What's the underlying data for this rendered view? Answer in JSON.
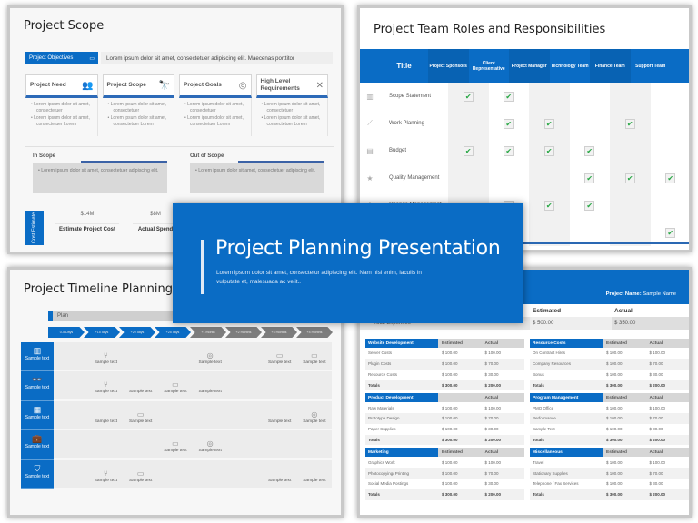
{
  "scope_slide": {
    "title": "Project Scope",
    "objectives_label": "Project Objectives",
    "objectives_icon": "monitor-icon",
    "objectives_text": "Lorem ipsum dolor sit amet, consectetuer adipiscing elit. Maecenas porttitor",
    "cards": [
      {
        "title": "Project Need",
        "icon": "people-icon",
        "glyph": "👥",
        "bullets": [
          "Lorem ipsum dolor sit amet, consectetuer",
          "Lorem ipsum dolor sit amet, consectetuer Lorem"
        ]
      },
      {
        "title": "Project Scope",
        "icon": "telescope-icon",
        "glyph": "🔭",
        "bullets": [
          "Lorem ipsum dolor sit amet, consectetuer",
          "Lorem ipsum dolor sit amet, consectetuer Lorem"
        ]
      },
      {
        "title": "Project Goals",
        "icon": "target-icon",
        "glyph": "◎",
        "bullets": [
          "Lorem ipsum dolor sit amet, consectetuer",
          "Lorem ipsum dolor sit amet, consectetuer Lorem"
        ]
      },
      {
        "title": "High Level Requirements",
        "icon": "tools-icon",
        "glyph": "✕",
        "bullets": [
          "Lorem ipsum dolor sit amet, consectetuer",
          "Lorem ipsum dolor sit amet, consectetuer Lorem"
        ]
      }
    ],
    "in_scope": {
      "label": "In Scope",
      "text": "Lorem ipsum dolor sit amet, consectetuer adipiscing elit."
    },
    "out_scope": {
      "label": "Out of Scope",
      "text": "Lorem ipsum dolor sit amet, consectetuer adipiscing elit."
    },
    "cost_tab": "Cost Estimate",
    "costs": [
      {
        "value": "$14M",
        "label": "Estimate Project Cost"
      },
      {
        "value": "$8M",
        "label": "Actual Spend"
      }
    ]
  },
  "roles_slide": {
    "title": "Project Team Roles and Responsibilities",
    "header_title": "Title",
    "columns": [
      "Project Sponsors",
      "Client Representative",
      "Project Manager",
      "Technology Team",
      "Finance Team",
      "Support Team"
    ],
    "check_glyph": "✔",
    "rows": [
      {
        "name": "Scope Statement",
        "icon": "bar-chart-icon",
        "glyph": "▥",
        "checks": [
          true,
          true,
          false,
          false,
          false,
          false
        ]
      },
      {
        "name": "Work Planning",
        "icon": "line-chart-icon",
        "glyph": "⟋",
        "checks": [
          false,
          true,
          true,
          false,
          true,
          false
        ]
      },
      {
        "name": "Budget",
        "icon": "money-icon",
        "glyph": "▤",
        "checks": [
          true,
          true,
          true,
          true,
          false,
          false
        ]
      },
      {
        "name": "Quality Management",
        "icon": "star-icon",
        "glyph": "★",
        "checks": [
          false,
          false,
          false,
          true,
          true,
          true
        ]
      },
      {
        "name": "Change Management",
        "icon": "team-icon",
        "glyph": "♟",
        "checks": [
          false,
          true,
          true,
          true,
          false,
          false
        ]
      },
      {
        "name": "",
        "icon": "",
        "glyph": "",
        "checks": [
          false,
          false,
          false,
          false,
          false,
          true
        ]
      }
    ]
  },
  "hero": {
    "title": "Project Planning Presentation",
    "subtitle": "Lorem ipsum dolor sit amet, consectetur adipiscing elit. Nam nisl enim, iaculis in vulputate et, malesuada ac velit.."
  },
  "timeline_slide": {
    "title": "Project Timeline Planning",
    "plan_label": "Plan",
    "milestones": [
      {
        "label": "0-5 Days",
        "state": "blue"
      },
      {
        "label": "+15 days",
        "state": "blue"
      },
      {
        "label": "+20 days",
        "state": "blue"
      },
      {
        "label": "+25 days",
        "state": "blue"
      },
      {
        "label": "+1 month",
        "state": "gray"
      },
      {
        "label": "+2 months",
        "state": "gray"
      },
      {
        "label": "+3 months",
        "state": "gray"
      },
      {
        "label": "+4 months",
        "state": "gray"
      }
    ],
    "side_items": [
      {
        "label": "Sample text",
        "icon": "bar-chart-icon",
        "glyph": "▥"
      },
      {
        "label": "Sample text",
        "icon": "binoculars-icon",
        "glyph": "👓"
      },
      {
        "label": "Sample text",
        "icon": "chart-icon",
        "glyph": "▦"
      },
      {
        "label": "Sample text",
        "icon": "briefcase-icon",
        "glyph": "💼"
      },
      {
        "label": "Sample text",
        "icon": "shield-icon",
        "glyph": "⛉"
      }
    ],
    "rows": [
      [
        null,
        {
          "icon": "workflow-icon",
          "glyph": "⑂",
          "label": "Sample text"
        },
        null,
        null,
        {
          "icon": "target-icon",
          "glyph": "◎",
          "label": "Sample text"
        },
        null,
        {
          "icon": "laptop-icon",
          "glyph": "▭",
          "label": "Sample text"
        },
        {
          "icon": "laptop-icon",
          "glyph": "▭",
          "label": "Sample text"
        }
      ],
      [
        null,
        {
          "icon": "workflow-icon",
          "glyph": "⑂",
          "label": "Sample text"
        },
        {
          "icon": "",
          "glyph": "",
          "label": "Sample text"
        },
        {
          "icon": "laptop-icon",
          "glyph": "▭",
          "label": "Sample text"
        },
        {
          "icon": "",
          "glyph": "",
          "label": "Sample text"
        },
        null,
        null,
        null
      ],
      [
        null,
        {
          "icon": "",
          "glyph": "",
          "label": "Sample text"
        },
        {
          "icon": "laptop-icon",
          "glyph": "▭",
          "label": "Sample text"
        },
        null,
        null,
        null,
        {
          "icon": "",
          "glyph": "",
          "label": "Sample text"
        },
        {
          "icon": "target-icon",
          "glyph": "◎",
          "label": "Sample text"
        }
      ],
      [
        null,
        null,
        null,
        {
          "icon": "laptop-icon",
          "glyph": "▭",
          "label": "Sample text"
        },
        {
          "icon": "target-icon",
          "glyph": "◎",
          "label": "Sample text"
        },
        null,
        null,
        null
      ],
      [
        null,
        {
          "icon": "workflow-icon",
          "glyph": "⑂",
          "label": "Sample text"
        },
        {
          "icon": "laptop-icon",
          "glyph": "▭",
          "label": "Sample text"
        },
        null,
        null,
        null,
        {
          "icon": "",
          "glyph": "",
          "label": "Sample text"
        },
        {
          "icon": "",
          "glyph": "",
          "label": "Sample text"
        }
      ]
    ]
  },
  "budget_slide": {
    "project_name_label": "Project Name:",
    "project_name": "Sample Name",
    "total_header": {
      "estimated": "Estimated",
      "actual": "Actual"
    },
    "total_row": {
      "label": "Total Expenses",
      "estimated": "$ 500.00",
      "actual": "$ 350.00"
    },
    "tables": [
      {
        "name": "Website Development",
        "est_label": "Estimated",
        "act_label": "Actual",
        "rows": [
          [
            "Server Costs",
            "$ 100.00",
            "$ 100.00"
          ],
          [
            "Plugin Costs",
            "$ 100.00",
            "$ 70.00"
          ],
          [
            "Resource Costs",
            "$ 100.00",
            "$ 30.00"
          ]
        ],
        "totals": [
          "Totals",
          "$ 300.00",
          "$ 200.00"
        ]
      },
      {
        "name": "Resource Costs",
        "est_label": "Estimated",
        "act_label": "Actual",
        "rows": [
          [
            "On Contract Hires",
            "$ 100.00",
            "$ 100.00"
          ],
          [
            "Company Resources",
            "$ 100.00",
            "$ 70.00"
          ],
          [
            "Bonus",
            "$ 100.00",
            "$ 30.00"
          ]
        ],
        "totals": [
          "Totals",
          "$ 300.00",
          "$ 200.00"
        ]
      },
      {
        "name": "Product Development",
        "est_label": "",
        "act_label": "Actual",
        "rows": [
          [
            "Raw Materials",
            "$ 100.00",
            "$ 100.00"
          ],
          [
            "Prototype Design",
            "$ 100.00",
            "$ 70.00"
          ],
          [
            "Paper Supplies",
            "$ 100.00",
            "$ 30.00"
          ]
        ],
        "totals": [
          "Totals",
          "$ 300.00",
          "$ 200.00"
        ]
      },
      {
        "name": "Program Management",
        "est_label": "Estimated",
        "act_label": "Actual",
        "rows": [
          [
            "PMO Office",
            "$ 100.00",
            "$ 100.00"
          ],
          [
            "Performance",
            "$ 100.00",
            "$ 70.00"
          ],
          [
            "Sample Text",
            "$ 100.00",
            "$ 30.00"
          ]
        ],
        "totals": [
          "Totals",
          "$ 300.00",
          "$ 200.00"
        ]
      },
      {
        "name": "Marketing",
        "est_label": "Estimated",
        "act_label": "Actual",
        "rows": [
          [
            "Graphics Work",
            "$ 100.00",
            "$ 100.00"
          ],
          [
            "Photocopying/ Printing",
            "$ 100.00",
            "$ 70.00"
          ],
          [
            "Social Media Postings",
            "$ 100.00",
            "$ 30.00"
          ]
        ],
        "totals": [
          "Totals",
          "$ 300.00",
          "$ 200.00"
        ]
      },
      {
        "name": "Miscellaneous",
        "est_label": "Estimated",
        "act_label": "Actual",
        "rows": [
          [
            "Travel",
            "$ 100.00",
            "$ 100.00"
          ],
          [
            "Stationary Supplies",
            "$ 100.00",
            "$ 70.00"
          ],
          [
            "Telephone / Fax Services",
            "$ 100.00",
            "$ 30.00"
          ]
        ],
        "totals": [
          "Totals",
          "$ 300.00",
          "$ 200.00"
        ]
      }
    ]
  }
}
